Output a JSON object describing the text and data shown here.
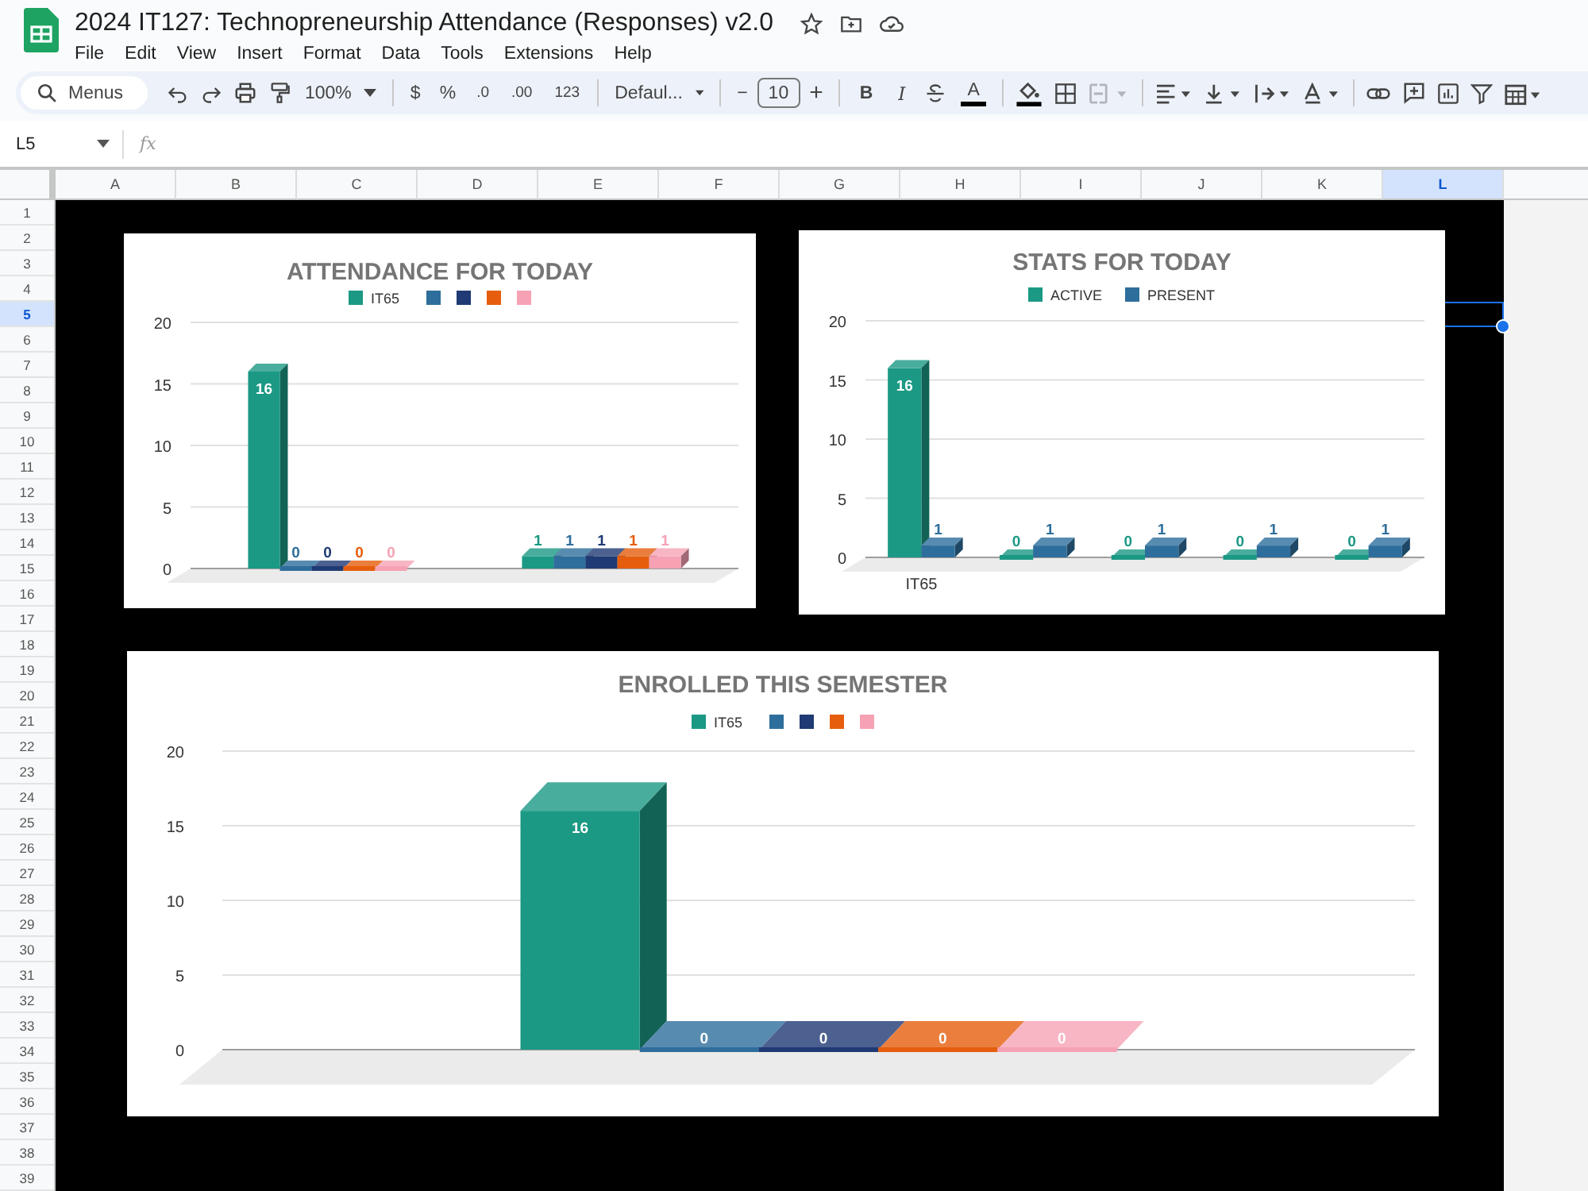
{
  "app": {
    "title": "2024 IT127: Technopreneurship Attendance (Responses) v2.0",
    "menu": [
      "File",
      "Edit",
      "View",
      "Insert",
      "Format",
      "Data",
      "Tools",
      "Extensions",
      "Help"
    ]
  },
  "toolbar": {
    "search_placeholder": "Menus",
    "zoom": "100%",
    "currency": "$",
    "percent": "%",
    "decrease_decimals": ".0",
    "increase_decimals": ".00",
    "number_format": "123",
    "font": "Defaul...",
    "minus": "−",
    "font_size": "10",
    "plus": "+",
    "bold": "B",
    "italic": "I",
    "text_color": "A",
    "merge_disabled": true
  },
  "formula_bar": {
    "cell_ref": "L5",
    "function_label": "fx"
  },
  "sheet": {
    "columns": [
      {
        "label": "A",
        "selected": false
      },
      {
        "label": "B",
        "selected": false
      },
      {
        "label": "C",
        "selected": false
      },
      {
        "label": "D",
        "selected": false
      },
      {
        "label": "E",
        "selected": false
      },
      {
        "label": "F",
        "selected": false
      },
      {
        "label": "G",
        "selected": false
      },
      {
        "label": "H",
        "selected": false
      },
      {
        "label": "I",
        "selected": false
      },
      {
        "label": "J",
        "selected": false
      },
      {
        "label": "K",
        "selected": false
      },
      {
        "label": "L",
        "selected": true
      }
    ],
    "rows": [
      {
        "label": "1",
        "selected": false
      },
      {
        "label": "2",
        "selected": false
      },
      {
        "label": "3",
        "selected": false
      },
      {
        "label": "4",
        "selected": false
      },
      {
        "label": "5",
        "selected": true
      },
      {
        "label": "6",
        "selected": false
      },
      {
        "label": "7",
        "selected": false
      },
      {
        "label": "8",
        "selected": false
      },
      {
        "label": "9",
        "selected": false
      },
      {
        "label": "10",
        "selected": false
      },
      {
        "label": "11",
        "selected": false
      },
      {
        "label": "12",
        "selected": false
      },
      {
        "label": "13",
        "selected": false
      },
      {
        "label": "14",
        "selected": false
      },
      {
        "label": "15",
        "selected": false
      },
      {
        "label": "16",
        "selected": false
      },
      {
        "label": "17",
        "selected": false
      },
      {
        "label": "18",
        "selected": false
      },
      {
        "label": "19",
        "selected": false
      },
      {
        "label": "20",
        "selected": false
      },
      {
        "label": "21",
        "selected": false
      },
      {
        "label": "22",
        "selected": false
      },
      {
        "label": "23",
        "selected": false
      },
      {
        "label": "24",
        "selected": false
      },
      {
        "label": "25",
        "selected": false
      },
      {
        "label": "26",
        "selected": false
      },
      {
        "label": "27",
        "selected": false
      },
      {
        "label": "28",
        "selected": false
      },
      {
        "label": "29",
        "selected": false
      },
      {
        "label": "30",
        "selected": false
      },
      {
        "label": "31",
        "selected": false
      },
      {
        "label": "32",
        "selected": false
      },
      {
        "label": "33",
        "selected": false
      },
      {
        "label": "34",
        "selected": false
      },
      {
        "label": "35",
        "selected": false
      },
      {
        "label": "36",
        "selected": false
      },
      {
        "label": "37",
        "selected": false
      },
      {
        "label": "38",
        "selected": false
      },
      {
        "label": "39",
        "selected": false
      }
    ],
    "charts": [
      {
        "chart_data": {
          "type": "bar",
          "title": "ATTENDANCE FOR TODAY",
          "grid": true,
          "legend": true,
          "categories": [
            null,
            null
          ],
          "ylim": [
            0,
            20
          ],
          "yticks": [
            0,
            5,
            10,
            15,
            20
          ],
          "data_labels": true,
          "series": [
            {
              "name": "IT65",
              "color": "#1b9984",
              "values": [
                16,
                1
              ]
            },
            {
              "color": "#2e6e9c",
              "values": [
                0,
                1
              ]
            },
            {
              "color": "#1f3a74",
              "values": [
                0,
                1
              ]
            },
            {
              "color": "#e65e0d",
              "values": [
                0,
                1
              ]
            },
            {
              "color": "#f6a2b4",
              "values": [
                0,
                1
              ]
            }
          ]
        }
      },
      {
        "chart_data": {
          "type": "bar",
          "title": "STATS FOR TODAY",
          "grid": true,
          "legend": true,
          "categories": [
            "IT65",
            null,
            null,
            null,
            null
          ],
          "ylim": [
            0,
            20
          ],
          "yticks": [
            0,
            5,
            10,
            15,
            20
          ],
          "data_labels": true,
          "series": [
            {
              "name": "ACTIVE",
              "color": "#1b9984",
              "values": [
                16,
                0,
                0,
                0,
                0
              ]
            },
            {
              "name": "PRESENT",
              "color": "#2e6e9c",
              "values": [
                1,
                1,
                1,
                1,
                1
              ]
            }
          ]
        }
      },
      {
        "chart_data": {
          "type": "bar",
          "title": "ENROLLED THIS SEMESTER",
          "grid": true,
          "legend": true,
          "categories": [
            null
          ],
          "ylim": [
            0,
            20
          ],
          "yticks": [
            0,
            5,
            10,
            15,
            20
          ],
          "data_labels": true,
          "series": [
            {
              "name": "IT65",
              "color": "#1b9984",
              "values": [
                16
              ]
            },
            {
              "color": "#2e6e9c",
              "values": [
                0
              ]
            },
            {
              "color": "#1f3a74",
              "values": [
                0
              ]
            },
            {
              "color": "#e65e0d",
              "values": [
                0
              ]
            },
            {
              "color": "#f6a2b4",
              "values": [
                0
              ]
            }
          ]
        }
      }
    ]
  }
}
